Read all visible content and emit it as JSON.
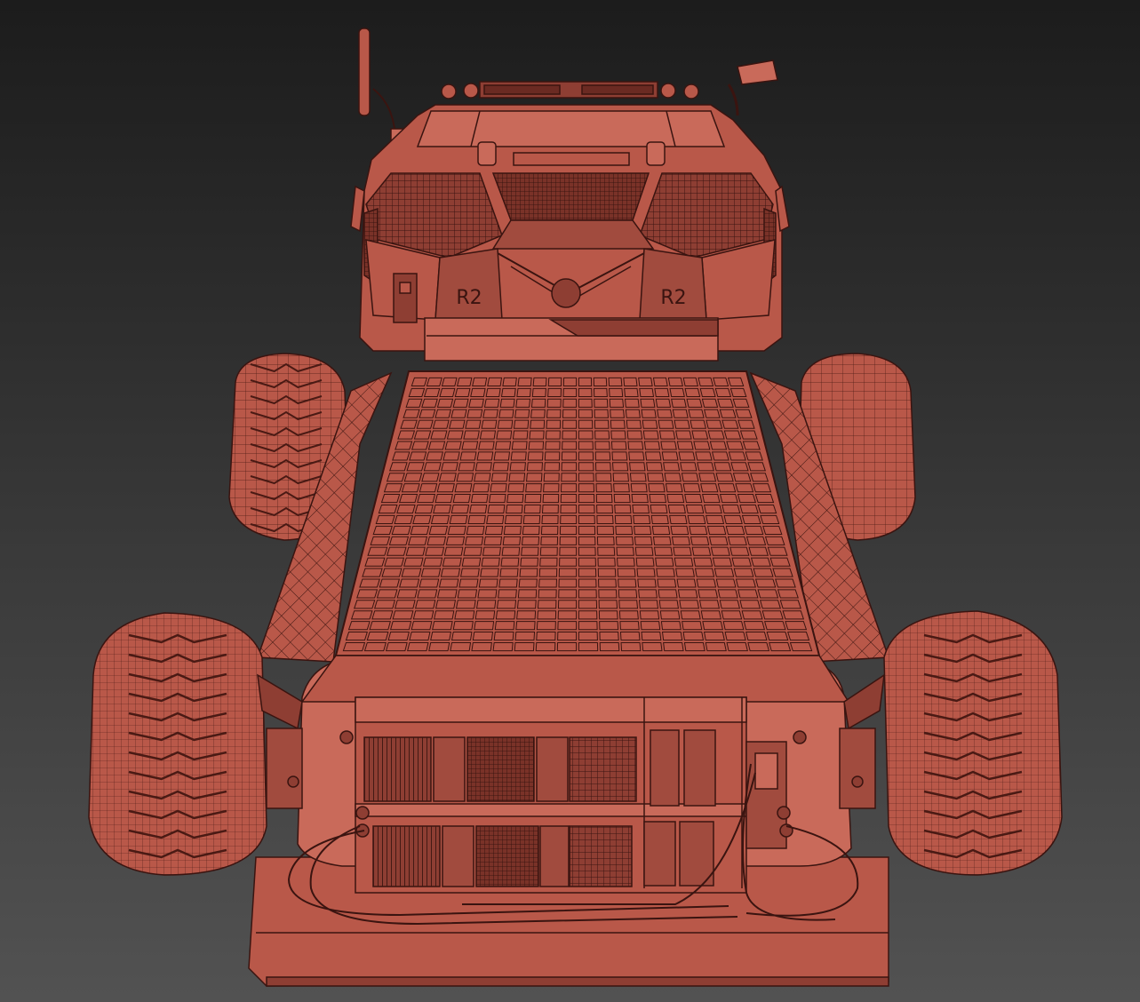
{
  "scene": {
    "colors": {
      "bg_top": "#1c1c1c",
      "bg_bottom": "#525252",
      "body": "#b95849",
      "body_light": "#c96a5a",
      "body_dark": "#8e3e33",
      "shadow": "#6a2a22",
      "wire": "#3a1410"
    },
    "cab": {
      "left_label": "R2",
      "right_label": "R2"
    },
    "solar_panel": {
      "rows": 26,
      "cols": 22
    }
  }
}
